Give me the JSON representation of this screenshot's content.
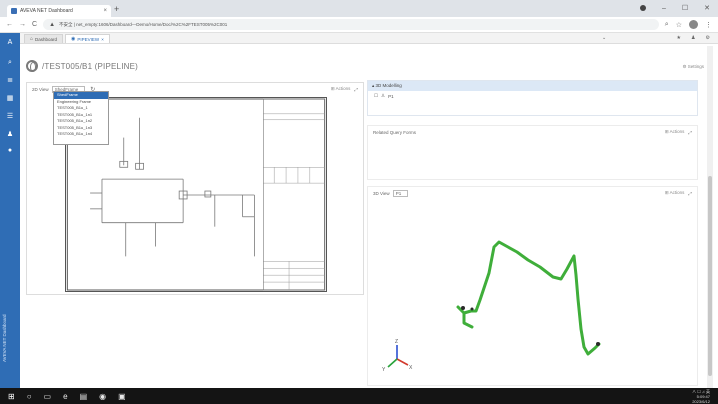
{
  "browser": {
    "tab_title": "AVEVA NET Dashboard",
    "tab_close": "×",
    "new_tab": "+",
    "url": "不安全 | net_empty:1606/Dashboard—Demo/Home/Doc/%2C%2FTEST005%2C001",
    "lock_text": "▲",
    "back": "←",
    "forward": "→",
    "reload": "C"
  },
  "rail": {
    "vertical_label": "AVEVA NET Dashboard"
  },
  "app_tabs": [
    {
      "label": "Dashboard",
      "icon": "home-icon"
    },
    {
      "label": "PIPEVIEW",
      "icon": "pipe-icon",
      "close": "×"
    }
  ],
  "page": {
    "title": "/TEST005/B1  (PIPELINE)",
    "settings": "⚙ Settings"
  },
  "left_panel": {
    "label": "2D View",
    "select_value": "ShedFrame",
    "actions_label": "⊞ Actions",
    "expand": "⤢",
    "dropdown_options": [
      "ShedFrame",
      "Engineering Frame",
      "TEST005_B1u_1",
      "TEST005_B1u_1n1",
      "TEST005_B1u_1n2",
      "TEST005_B1u_1n3",
      "TEST005_B1u_1n4"
    ]
  },
  "right_top": {
    "header": "▴ 3D Modelling",
    "row_label": "P1"
  },
  "right_mid": {
    "label": "Related Query Forms",
    "actions": "⊞ Actions",
    "expand": "⤢"
  },
  "right_3d": {
    "label": "3D View",
    "select_value": "P1",
    "actions": "⊞ Actions",
    "expand": "⤢"
  },
  "axes": {
    "x": "X",
    "y": "Y",
    "z": "Z"
  },
  "taskbar": {
    "time": "5:09:47",
    "date": "2023/6/12",
    "tray": "∧ ☐ ♫ 英"
  },
  "colors": {
    "rail": "#2f6db5",
    "pipe": "#3fae3a",
    "axis_x": "#d23a2d",
    "axis_y": "#28a23a",
    "axis_z": "#2a4fd0"
  }
}
